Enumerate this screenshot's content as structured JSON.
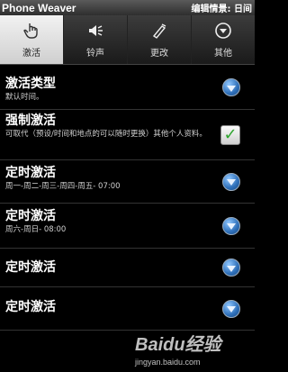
{
  "app": {
    "title": "Phone Weaver",
    "status": "编辑情景: 日间"
  },
  "tabs": [
    {
      "label": "激活",
      "icon": "hand-pointer-icon",
      "active": true
    },
    {
      "label": "铃声",
      "icon": "speaker-icon",
      "active": false
    },
    {
      "label": "更改",
      "icon": "phone-edit-icon",
      "active": false
    },
    {
      "label": "其他",
      "icon": "down-circle-icon",
      "active": false
    }
  ],
  "rows": [
    {
      "title": "激活类型",
      "subtitle": "默认时间。",
      "control": "dropdown"
    },
    {
      "title": "强制激活",
      "subtitle": "可取代（预设/时间和地点的可以随时更换）其他个人资料。",
      "control": "checkbox",
      "checked": true
    },
    {
      "title": "定时激活",
      "subtitle": "周一-周二-周三-周四-周五-    07:00",
      "control": "dropdown"
    },
    {
      "title": "定时激活",
      "subtitle": "周六-周日-    08:00",
      "control": "dropdown"
    },
    {
      "title": "定时激活",
      "subtitle": "",
      "control": "dropdown"
    },
    {
      "title": "定时激活",
      "subtitle": "",
      "control": "dropdown"
    }
  ],
  "watermark": {
    "logo": "Baidu经验",
    "url": "jingyan.baidu.com"
  }
}
